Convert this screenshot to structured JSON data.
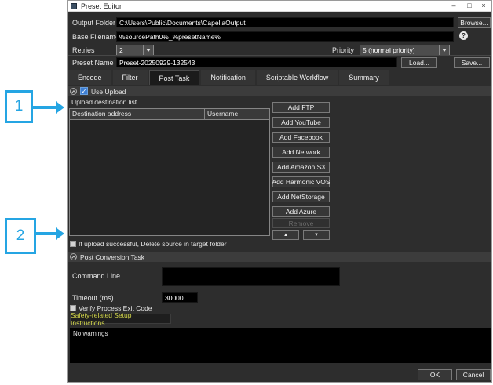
{
  "annotations": {
    "color": "#25a5e3",
    "callouts": [
      {
        "number": "1"
      },
      {
        "number": "2"
      }
    ]
  },
  "window": {
    "title": "Preset Editor",
    "controls": {
      "minimize": "–",
      "maximize": "□",
      "close": "×"
    }
  },
  "fields": {
    "output_folder": {
      "label": "Output Folder",
      "value": "C:\\Users\\Public\\Documents\\CapellaOutput",
      "browse": "Browse..."
    },
    "base_filename": {
      "label": "Base Filename",
      "value": "%sourcePath0%_%presetName%"
    },
    "retries": {
      "label": "Retries",
      "value": "2"
    },
    "priority": {
      "label": "Priority",
      "value": "5 (normal priority)"
    },
    "preset_name": {
      "label": "Preset Name",
      "value": "Preset-20250929-132543",
      "load": "Load...",
      "save": "Save..."
    }
  },
  "help_icon_glyph": "?",
  "tabs": [
    {
      "label": "Encode",
      "active": false
    },
    {
      "label": "Filter",
      "active": false
    },
    {
      "label": "Post Task",
      "active": true
    },
    {
      "label": "Notification",
      "active": false
    },
    {
      "label": "Scriptable Workflow",
      "active": false
    },
    {
      "label": "Summary",
      "active": false
    }
  ],
  "post_task": {
    "use_upload": {
      "label": "Use Upload",
      "checked": true
    },
    "list_label": "Upload destination list",
    "table": {
      "columns": [
        "Destination address",
        "Username"
      ],
      "rows": []
    },
    "add_buttons": [
      "Add FTP",
      "Add YouTube",
      "Add Facebook",
      "Add Network",
      "Add Amazon S3",
      "Add Harmonic VOS",
      "Add NetStorage",
      "Add Azure"
    ],
    "remove_button": "Remove",
    "move_up_icon": "▲",
    "move_down_icon": "▼",
    "delete_source": {
      "label": "If upload successful, Delete source in target folder",
      "checked": false
    }
  },
  "post_conversion": {
    "section_label": "Post Conversion Task",
    "command_line": {
      "label": "Command Line",
      "value": ""
    },
    "timeout": {
      "label": "Timeout (ms)",
      "value": "30000"
    },
    "verify_exit_code": {
      "label": "Verify Process Exit Code",
      "checked": false
    },
    "safety_button": "Safety-related Setup Instructions..."
  },
  "warnings": {
    "text": "No warnings"
  },
  "footer": {
    "ok": "OK",
    "cancel": "Cancel"
  },
  "icons": {
    "checkmark": "✓"
  },
  "colors": {
    "accent_blue": "#25a5e3",
    "checkbox_blue": "#3d7ed3",
    "safety_yellow": "#d6d94c",
    "panel_bg": "#2d2d2d",
    "input_bg": "#000000",
    "titlebar_bg": "#ffffff"
  }
}
